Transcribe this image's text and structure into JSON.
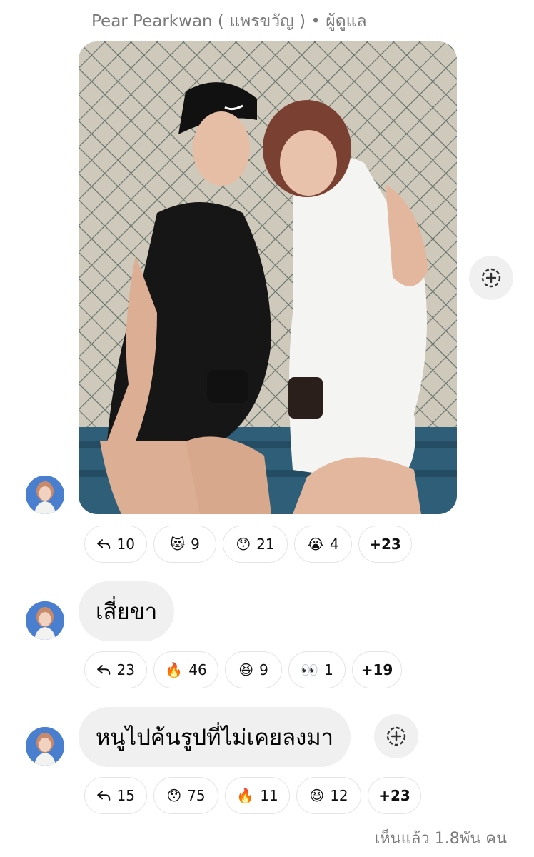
{
  "sender_line": "Pear Pearkwan ( แพรขวัญ ) • ผู้ดูแล",
  "messages": [
    {
      "kind": "photo",
      "reactions": [
        {
          "icon": "reply-icon",
          "count": "10"
        },
        {
          "icon": "heart-eyes-cat-emoji",
          "glyph": "😻",
          "count": "9"
        },
        {
          "icon": "hushed-face-emoji",
          "glyph": "😯",
          "count": "21"
        },
        {
          "icon": "crying-face-emoji",
          "glyph": "😭",
          "count": "4"
        },
        {
          "more": "+23"
        }
      ]
    },
    {
      "kind": "text",
      "text": "เสี่ยขา",
      "reactions": [
        {
          "icon": "reply-icon",
          "count": "23"
        },
        {
          "icon": "fire-emoji",
          "glyph": "🔥",
          "count": "46"
        },
        {
          "icon": "grinning-squint-emoji",
          "glyph": "😆",
          "count": "9"
        },
        {
          "icon": "eyes-emoji",
          "glyph": "👀",
          "count": "1"
        },
        {
          "more": "+19"
        }
      ]
    },
    {
      "kind": "text",
      "text": "หนูไปค้นรูปที่ไม่เคยลงมา",
      "reactions": [
        {
          "icon": "reply-icon",
          "count": "15"
        },
        {
          "icon": "hushed-face-emoji",
          "glyph": "😯",
          "count": "75"
        },
        {
          "icon": "fire-emoji",
          "glyph": "🔥",
          "count": "11"
        },
        {
          "icon": "grinning-squint-emoji",
          "glyph": "😆",
          "count": "12"
        },
        {
          "more": "+23"
        }
      ]
    }
  ],
  "seen_text": "เห็นแล้ว 1.8พัน คน",
  "colors": {
    "bubble": "#f0f0f0",
    "pill_border": "#e4e4e4",
    "muted_text": "#7a7a7a",
    "avatar_bg": "#4a7fd0"
  }
}
